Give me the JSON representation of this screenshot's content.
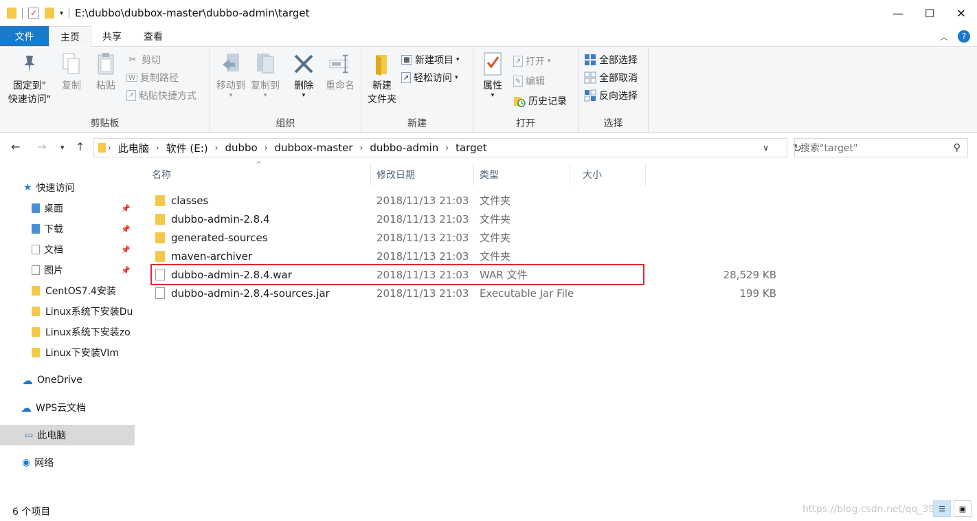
{
  "window": {
    "title": "E:\\dubbo\\dubbox-master\\dubbo-admin\\target",
    "minimize": "—",
    "maximize": "☐",
    "close": "✕"
  },
  "ribbon_tabs": [
    "文件",
    "主页",
    "共享",
    "查看"
  ],
  "ribbon": {
    "clipboard": {
      "label": "剪贴板",
      "pin_line1": "固定到\"",
      "pin_line2": "快速访问\"",
      "copy": "复制",
      "paste": "粘贴",
      "cut": "剪切",
      "copy_path": "复制路径",
      "paste_shortcut": "粘贴快捷方式"
    },
    "organize": {
      "label": "组织",
      "move_to": "移动到",
      "copy_to": "复制到",
      "delete": "删除",
      "rename": "重命名"
    },
    "new": {
      "label": "新建",
      "new_folder_line1": "新建",
      "new_folder_line2": "文件夹",
      "new_item": "新建项目",
      "easy_access": "轻松访问"
    },
    "open": {
      "label": "打开",
      "properties": "属性",
      "open": "打开",
      "edit": "编辑",
      "history": "历史记录"
    },
    "select": {
      "label": "选择",
      "select_all": "全部选择",
      "select_none": "全部取消",
      "invert": "反向选择"
    }
  },
  "address": {
    "crumbs": [
      "此电脑",
      "软件 (E:)",
      "dubbo",
      "dubbox-master",
      "dubbo-admin",
      "target"
    ],
    "search_placeholder": "搜索\"target\""
  },
  "nav": {
    "quick_access": "快速访问",
    "items": [
      {
        "label": "桌面",
        "pinned": true
      },
      {
        "label": "下载",
        "pinned": true
      },
      {
        "label": "文档",
        "pinned": true
      },
      {
        "label": "图片",
        "pinned": true
      },
      {
        "label": "CentOS7.4安装",
        "pinned": false
      },
      {
        "label": "Linux系统下安装Du",
        "pinned": false
      },
      {
        "label": "Linux系统下安装zo",
        "pinned": false
      },
      {
        "label": "Linux下安装VIm",
        "pinned": false
      }
    ],
    "onedrive": "OneDrive",
    "wps": "WPS云文档",
    "this_pc": "此电脑",
    "network": "网络"
  },
  "columns": {
    "name": "名称",
    "date": "修改日期",
    "type": "类型",
    "size": "大小"
  },
  "files": [
    {
      "name": "classes",
      "date": "2018/11/13 21:03",
      "type": "文件夹",
      "size": "",
      "kind": "folder"
    },
    {
      "name": "dubbo-admin-2.8.4",
      "date": "2018/11/13 21:03",
      "type": "文件夹",
      "size": "",
      "kind": "folder"
    },
    {
      "name": "generated-sources",
      "date": "2018/11/13 21:03",
      "type": "文件夹",
      "size": "",
      "kind": "folder"
    },
    {
      "name": "maven-archiver",
      "date": "2018/11/13 21:03",
      "type": "文件夹",
      "size": "",
      "kind": "folder"
    },
    {
      "name": "dubbo-admin-2.8.4.war",
      "date": "2018/11/13 21:03",
      "type": "WAR 文件",
      "size": "28,529 KB",
      "kind": "file"
    },
    {
      "name": "dubbo-admin-2.8.4-sources.jar",
      "date": "2018/11/13 21:03",
      "type": "Executable Jar File",
      "size": "199 KB",
      "kind": "file"
    }
  ],
  "status": {
    "count": "6 个项目",
    "watermark": "https://blog.csdn.net/qq_39"
  },
  "colors": {
    "file_tab": "#1979ca",
    "highlight": "#e0282d",
    "folder": "#f5c84a"
  }
}
